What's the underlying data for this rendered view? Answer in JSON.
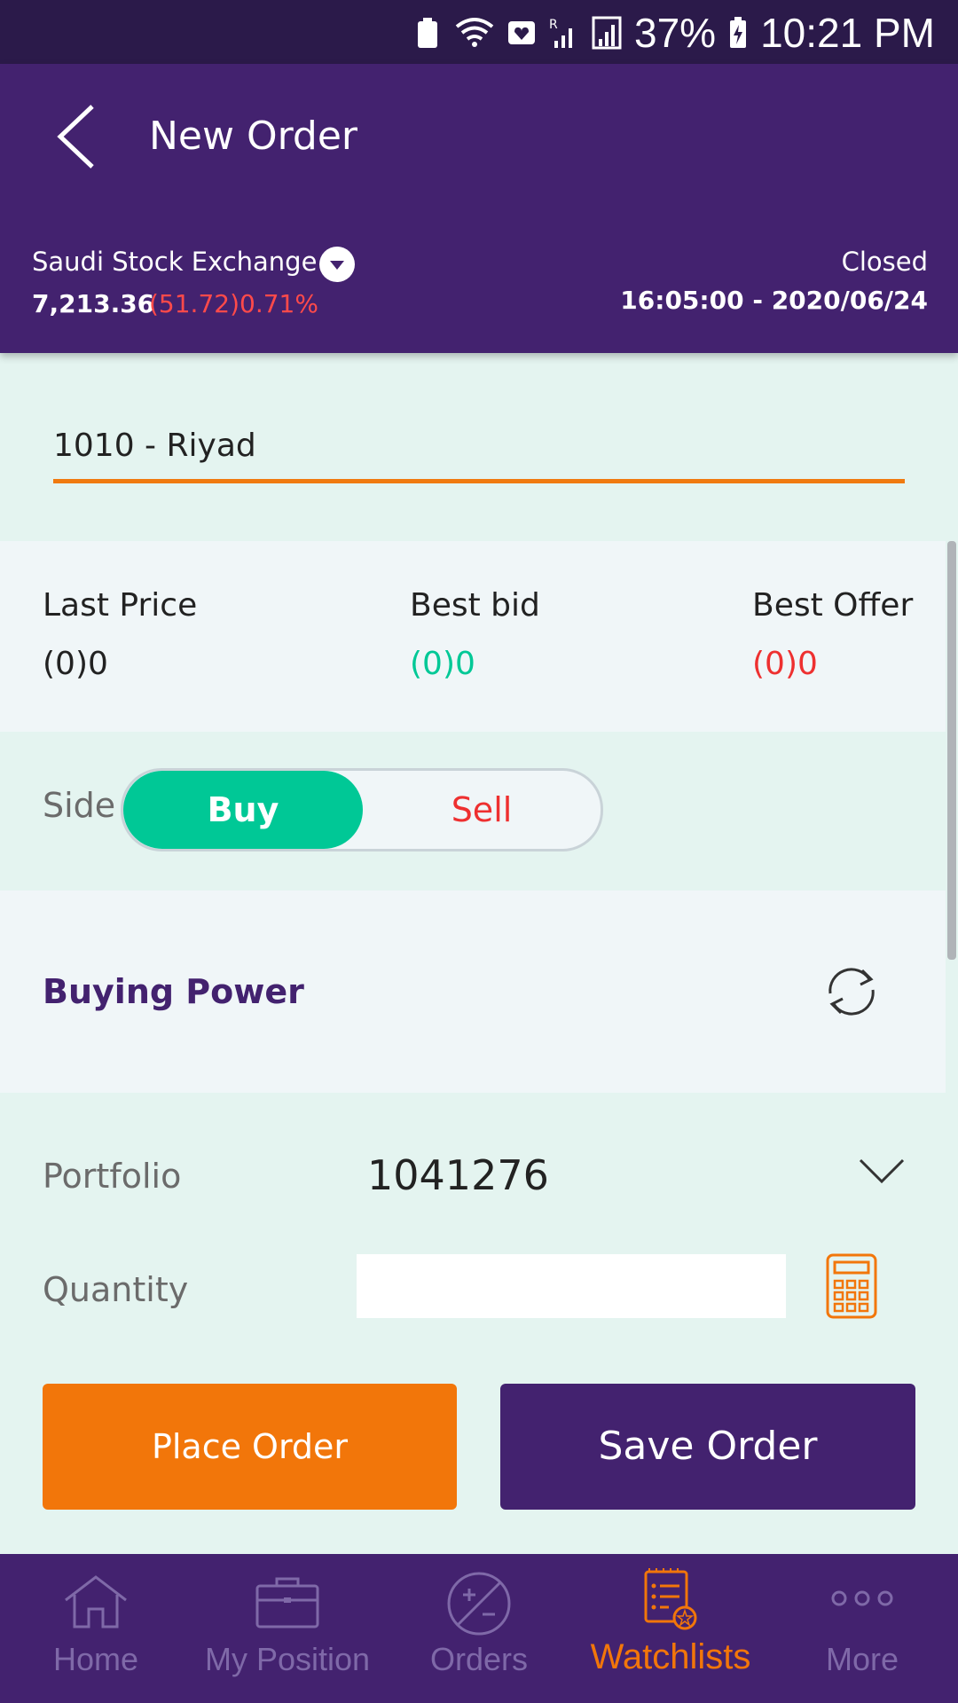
{
  "status_bar": {
    "battery_percent": "37%",
    "time": "10:21 PM"
  },
  "header": {
    "title": "New Order",
    "exchange_name": "Saudi Stock Exchange",
    "index_value": "7,213.36",
    "index_change": "(51.72)0.71%",
    "market_status": "Closed",
    "market_time": "16:05:00 - 2020/06/24"
  },
  "symbol": {
    "value": "1010 - Riyad"
  },
  "prices": {
    "last_price_label": "Last Price",
    "last_price_value": "(0)0",
    "best_bid_label": "Best bid",
    "best_bid_value": "(0)0",
    "best_offer_label": "Best Offer",
    "best_offer_value": "(0)0"
  },
  "side": {
    "label": "Side",
    "buy": "Buy",
    "sell": "Sell",
    "selected": "Buy"
  },
  "buying_power": {
    "label": "Buying Power"
  },
  "portfolio": {
    "label": "Portfolio",
    "value": "1041276"
  },
  "quantity": {
    "label": "Quantity",
    "value": ""
  },
  "actions": {
    "place_order": "Place Order",
    "save_order": "Save Order"
  },
  "nav": {
    "items": [
      {
        "label": "Home",
        "icon": "home-icon"
      },
      {
        "label": "My Position",
        "icon": "briefcase-icon"
      },
      {
        "label": "Orders",
        "icon": "orders-icon"
      },
      {
        "label": "Watchlists",
        "icon": "watchlist-icon",
        "active": true
      },
      {
        "label": "More",
        "icon": "more-icon"
      }
    ]
  },
  "colors": {
    "primary": "#43226f",
    "accent": "#f2760a",
    "buy": "#00c896",
    "sell": "#ee3030"
  }
}
